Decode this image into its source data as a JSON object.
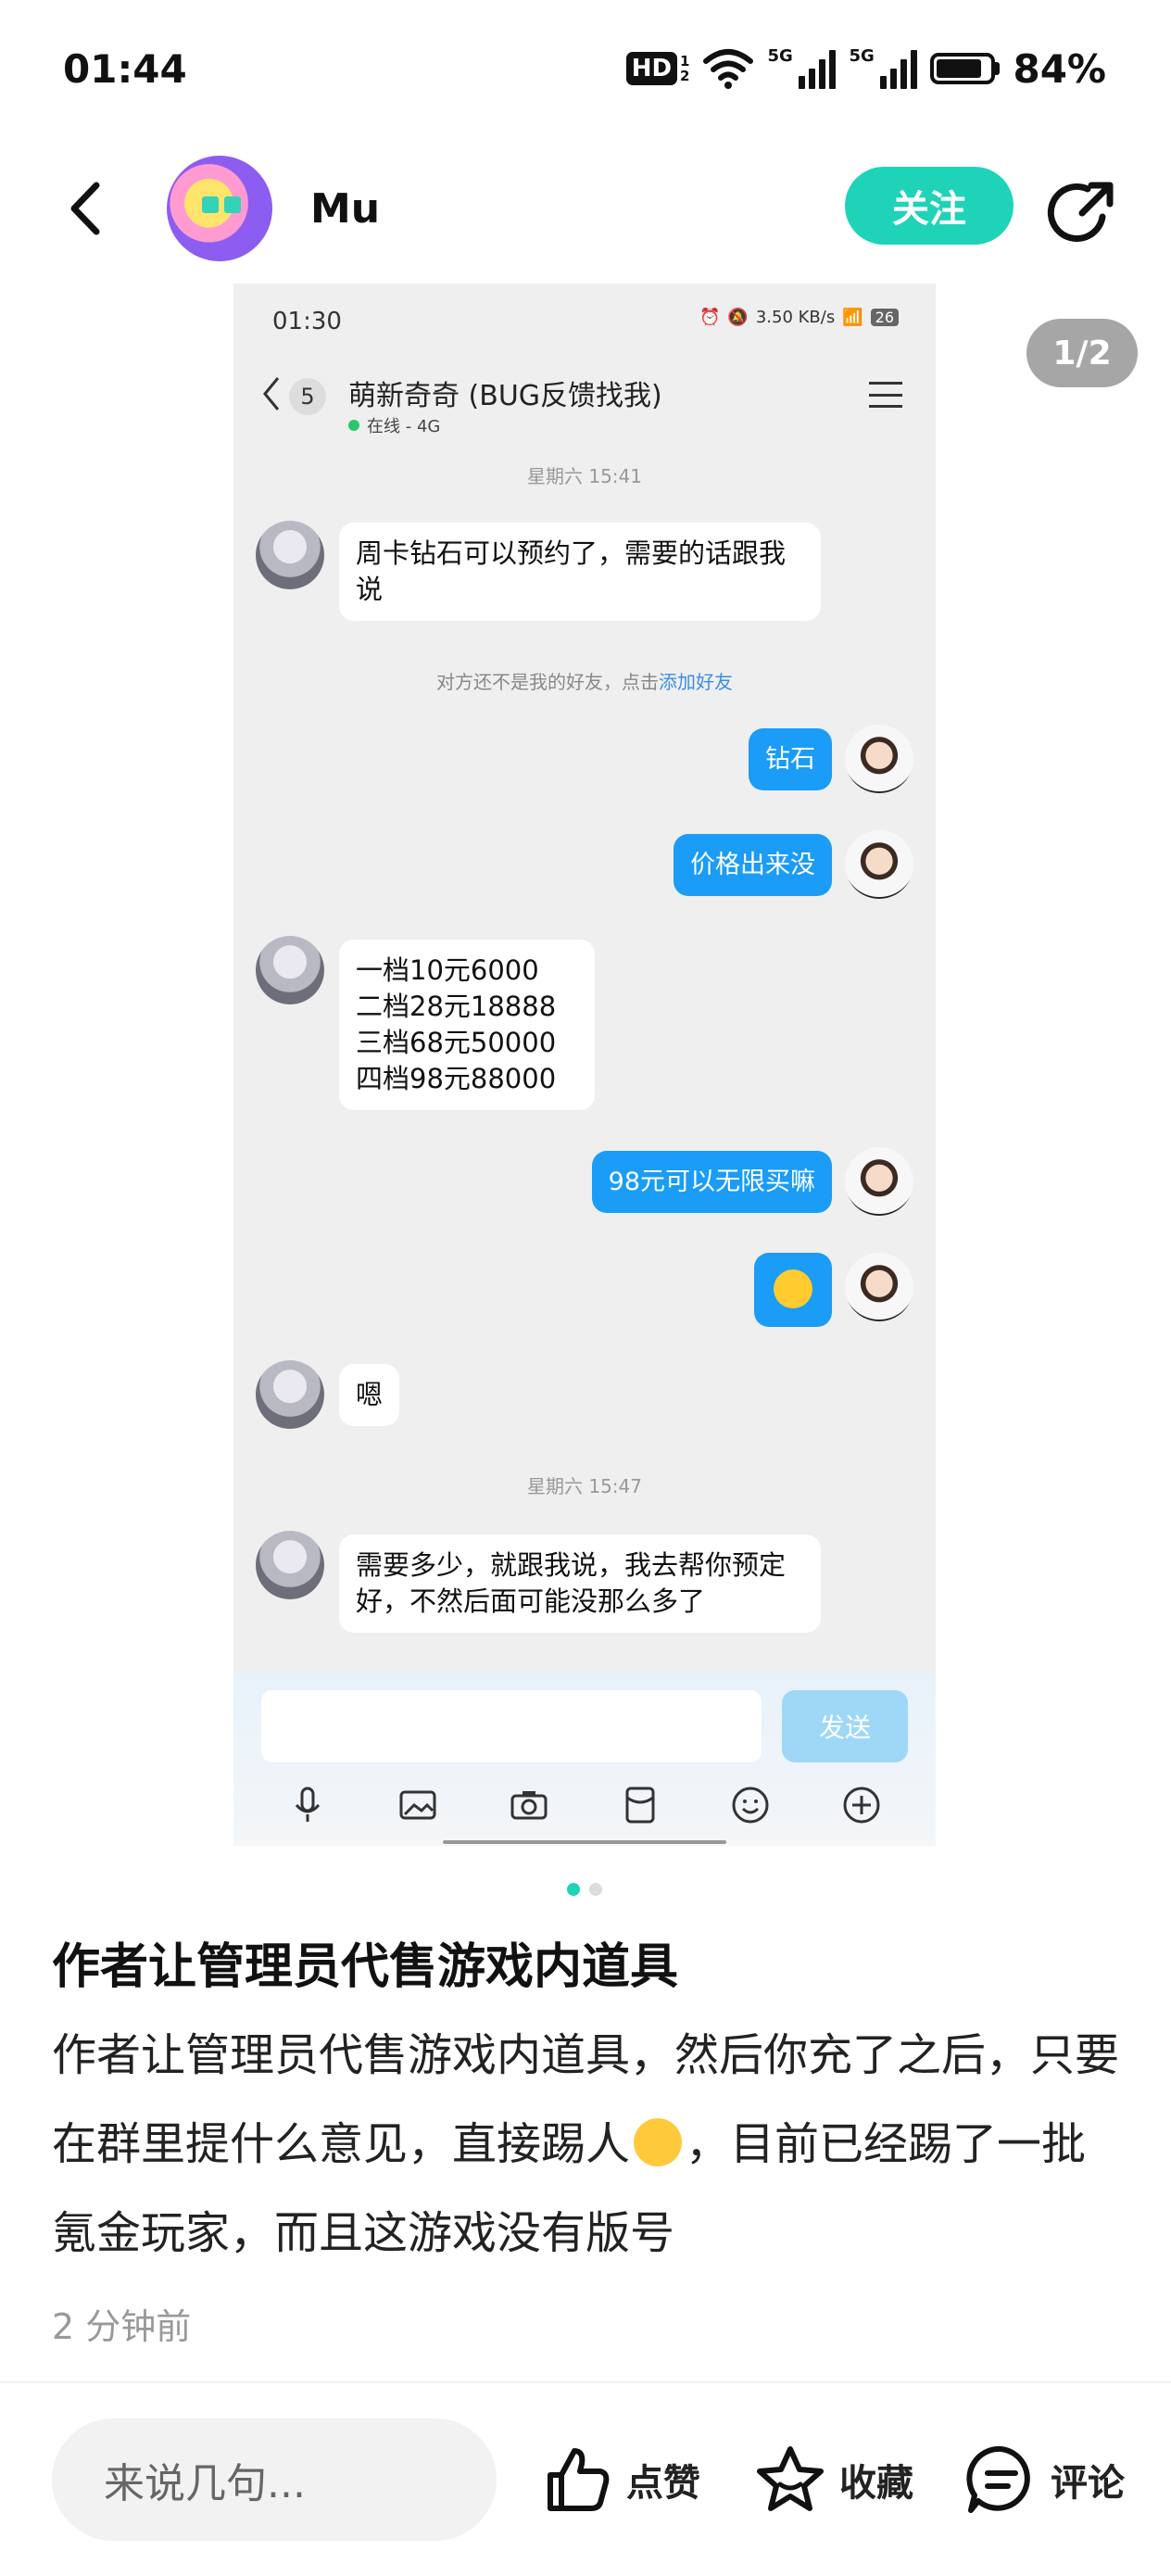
{
  "status_bar": {
    "time": "01:44",
    "hd_label": "HD",
    "hd_sub_top": "1",
    "hd_sub_bottom": "2",
    "signal1_label": "5G",
    "signal2_label": "5G",
    "battery_text": "84%",
    "battery_level": 0.84
  },
  "header": {
    "username": "Mu",
    "follow_label": "关注"
  },
  "image_viewer": {
    "page_indicator": "1/2",
    "dots_count": 2,
    "active_dot": 0
  },
  "screenshot": {
    "status_time": "01:30",
    "status_speed": "3.50 KB/s",
    "status_battery": "26",
    "chat_count": "5",
    "chat_title": "萌新奇奇 (BUG反馈找我)",
    "chat_status": "在线 - 4G",
    "timestamp1": "星期六 15:41",
    "msg1": "周卡钻石可以预约了，需要的话跟我说",
    "sys_note_prefix": "对方还不是我的好友，点击",
    "sys_note_link": "添加好友",
    "msg2": "钻石",
    "msg3": "价格出来没",
    "msg4_lines": [
      "一档10元6000",
      "二档28元18888",
      "三档68元50000",
      "四档98元88000"
    ],
    "msg5": "98元可以无限买嘛",
    "msg7": "嗯",
    "timestamp2": "星期六 15:47",
    "msg8": "需要多少，就跟我说，我去帮你预定好，不然后面可能没那么多了",
    "send_label": "发送"
  },
  "post": {
    "title": "作者让管理员代售游戏内道具",
    "body_part1": "作者让管理员代售游戏内道具，然后你充了之后，只要在群里提什么意见，直接踢人",
    "body_part2": "，目前已经踢了一批氪金玩家，而且这游戏没有版号",
    "time": "2 分钟前"
  },
  "bottom_bar": {
    "comment_placeholder": "来说几句...",
    "like_label": "点赞",
    "favorite_label": "收藏",
    "comment_label": "评论"
  },
  "colors": {
    "accent": "#1fd3b8",
    "chat_bubble_blue": "#1a9cf7"
  }
}
